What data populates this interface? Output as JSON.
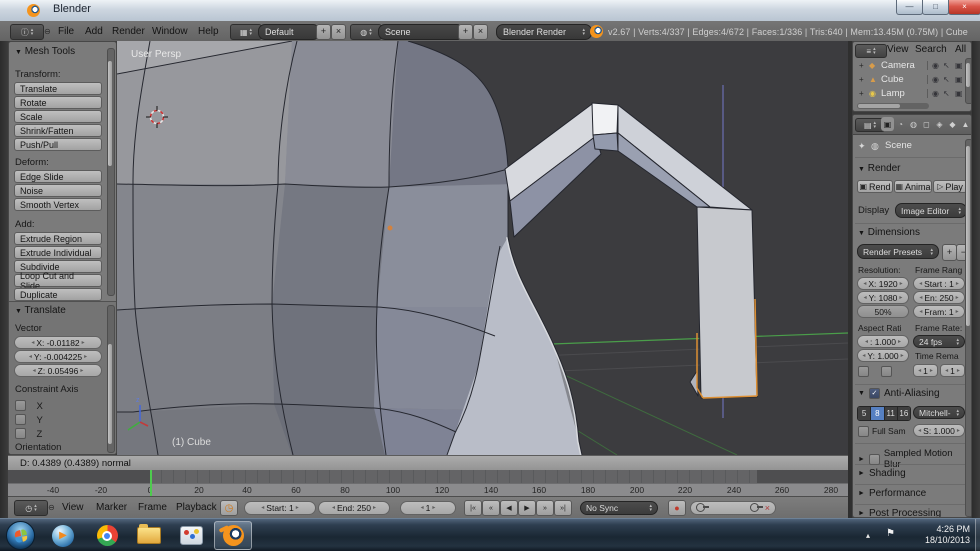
{
  "window": {
    "title": "Blender",
    "min_glyph": "—",
    "max_glyph": "□",
    "close_glyph": "×"
  },
  "colors": {
    "selection_orange": "#dd8f33",
    "sample_active_blue": "#5680c2",
    "frame_cursor_green": "#4ecb4e"
  },
  "icons": {
    "info_editor": "ⓘ",
    "timeline_editor": "◷",
    "outliner_editor": "≡",
    "properties_editor": "▤",
    "layout_browser": "▦",
    "scene_browser": "◍",
    "collapse_menus": "⊖",
    "dropdown_up": "▴",
    "dropdown_down": "▾",
    "panel_open": "▼",
    "panel_closed": "►",
    "add": "+",
    "close": "×",
    "remove": "−",
    "check": "✓",
    "arrow_left": "◂",
    "arrow_right": "▸",
    "preview_clock": "◷",
    "record": "●",
    "jump_start": "|«",
    "prev_key": "«",
    "play_reverse": "◀",
    "play": "▶",
    "next_key": "»",
    "jump_end": "»|",
    "camera_obj": "◆",
    "mesh_obj": "▲",
    "lamp_obj": "◉",
    "eye": "◉",
    "select_arrow": "↖",
    "render_restrict": "▣",
    "pin": "✦",
    "rend_icon": "▣",
    "anima_icon": "▦",
    "play_icon": "▷",
    "tray_up": "▴",
    "tray_flag": "⚑",
    "prop_tabs": [
      "▣",
      "◔",
      "◍",
      "◻",
      "◈",
      "◆",
      "▲",
      "○"
    ]
  },
  "info_bar": {
    "menus": [
      "File",
      "Add",
      "Render",
      "Window",
      "Help"
    ],
    "layout": "Default",
    "scene": "Scene",
    "engine": "Blender Render",
    "stats": "v2.67 | Verts:4/337 | Edges:4/672 | Faces:1/336 | Tris:640 | Mem:13.45M (0.75M) | Cube"
  },
  "tool_shelf": {
    "panel_title": "Mesh Tools",
    "sections": [
      {
        "label": "Transform:",
        "buttons": [
          "Translate",
          "Rotate",
          "Scale",
          "Shrink/Fatten",
          "Push/Pull"
        ]
      },
      {
        "label": "Deform:",
        "buttons": [
          "Edge Slide",
          "Noise",
          "Smooth Vertex"
        ]
      },
      {
        "label": "Add:",
        "buttons": [
          "Extrude Region",
          "Extrude Individual",
          "Subdivide",
          "Loop Cut and Slide",
          "Duplicate"
        ]
      }
    ],
    "operator_panel": {
      "title": "Translate",
      "vector_label": "Vector",
      "x": "X: -0.01182",
      "y": "Y: -0.004225",
      "z": "Z: 0.05496",
      "constraint_label": "Constraint Axis",
      "axes": [
        "X",
        "Y",
        "Z"
      ],
      "orientation_label": "Orientation"
    }
  },
  "viewport": {
    "view_label": "User Persp",
    "object_info": "(1) Cube",
    "header_status": "D: 0.4389 (0.4389) normal",
    "gizmo_z_label": "z"
  },
  "timeline": {
    "menus": [
      "View",
      "Marker",
      "Frame",
      "Playback"
    ],
    "start_field": "Start: 1",
    "end_field": "End: 250",
    "current_frame": "1",
    "sync_mode": "No Sync",
    "ticks": [
      "-40",
      "-20",
      "0",
      "20",
      "40",
      "60",
      "80",
      "100",
      "120",
      "140",
      "160",
      "180",
      "200",
      "220",
      "240",
      "260",
      "280"
    ]
  },
  "outliner": {
    "menu": {
      "view": "View",
      "search": "Search",
      "filter": "All"
    },
    "items": [
      "Camera",
      "Cube",
      "Lamp"
    ]
  },
  "properties": {
    "breadcrumb": "Scene",
    "render": {
      "title": "Render",
      "render_btn": "Rend",
      "anim_btn": "Anima",
      "play_btn": "Play",
      "display_label": "Display",
      "display_value": "Image Editor"
    },
    "dimensions": {
      "title": "Dimensions",
      "presets": "Render Presets",
      "resolution_label": "Resolution:",
      "res_x": "X: 1920",
      "res_y": "Y: 1080",
      "res_pct": "50%",
      "frame_range_label": "Frame Rang",
      "start": "Start : 1",
      "end": "En: 250",
      "step": "Fram: 1",
      "aspect_label": "Aspect Rati",
      "aspect_x": ": 1.000",
      "aspect_y": "Y: 1.000",
      "frame_rate_label": "Frame Rate:",
      "fps": "24 fps",
      "time_remap_label": "Time Rema",
      "remap_a": "1",
      "remap_b": "1"
    },
    "anti_aliasing": {
      "title": "Anti-Aliasing",
      "samples": [
        "5",
        "8",
        "11",
        "16"
      ],
      "filter": "Mitchell-",
      "full_sample_label": "Full Sam",
      "size": "S: 1.000"
    },
    "collapsed_panels": [
      "Sampled Motion Blur",
      "Shading",
      "Performance",
      "Post Processing"
    ]
  },
  "taskbar": {
    "time": "4:26 PM",
    "date": "18/10/2013"
  }
}
